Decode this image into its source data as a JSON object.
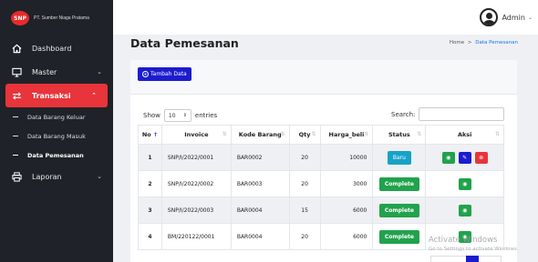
{
  "brand": {
    "logo_text": "SNP",
    "name": "PT. Sumber Niaga Pratama"
  },
  "sidebar": {
    "items": [
      {
        "label": "Dashboard",
        "icon": "home-icon"
      },
      {
        "label": "Master",
        "icon": "monitor-icon"
      },
      {
        "label": "Transaksi",
        "icon": "exchange-icon",
        "active": true
      },
      {
        "label": "Laporan",
        "icon": "printer-icon"
      }
    ],
    "sub_items": [
      {
        "label": "Data Barang Keluar"
      },
      {
        "label": "Data Barang Masuk"
      },
      {
        "label": "Data Pemesanan",
        "active": true
      }
    ]
  },
  "user": {
    "name": "Admin"
  },
  "page": {
    "title": "Data Pemesanan",
    "breadcrumb_home": "Home",
    "breadcrumb_sep": ">",
    "breadcrumb_current": "Data Pemesanan"
  },
  "toolbar": {
    "add_label": "Tambah Data"
  },
  "table_controls": {
    "show_label": "Show",
    "entries_value": "10",
    "entries_label": "entries",
    "search_label": "Search:"
  },
  "table": {
    "headers": [
      "No",
      "Invoice",
      "Kode Barang",
      "Qty",
      "Harga_beli",
      "Status",
      "Aksi"
    ],
    "rows": [
      {
        "no": "1",
        "invoice": "SNP/I/2022/0001",
        "kode": "BAR0002",
        "qty": "20",
        "harga": "10000",
        "status": "Baru"
      },
      {
        "no": "2",
        "invoice": "SNP/I/2022/0002",
        "kode": "BAR0003",
        "qty": "20",
        "harga": "3000",
        "status": "Complete"
      },
      {
        "no": "3",
        "invoice": "SNP/I/2022/0003",
        "kode": "BAR0004",
        "qty": "15",
        "harga": "6000",
        "status": "Complete"
      },
      {
        "no": "4",
        "invoice": "BM/220122/0001",
        "kode": "BAR0004",
        "qty": "20",
        "harga": "6000",
        "status": "Complete"
      }
    ]
  },
  "watermark": {
    "line1": "Activate Windows",
    "line2": "Go to Settings to activate Windows."
  },
  "colors": {
    "accent": "#e8343b",
    "primary": "#1c1ccf",
    "success": "#21a24c",
    "info": "#17a2c8",
    "sidebar": "#1f2228"
  }
}
